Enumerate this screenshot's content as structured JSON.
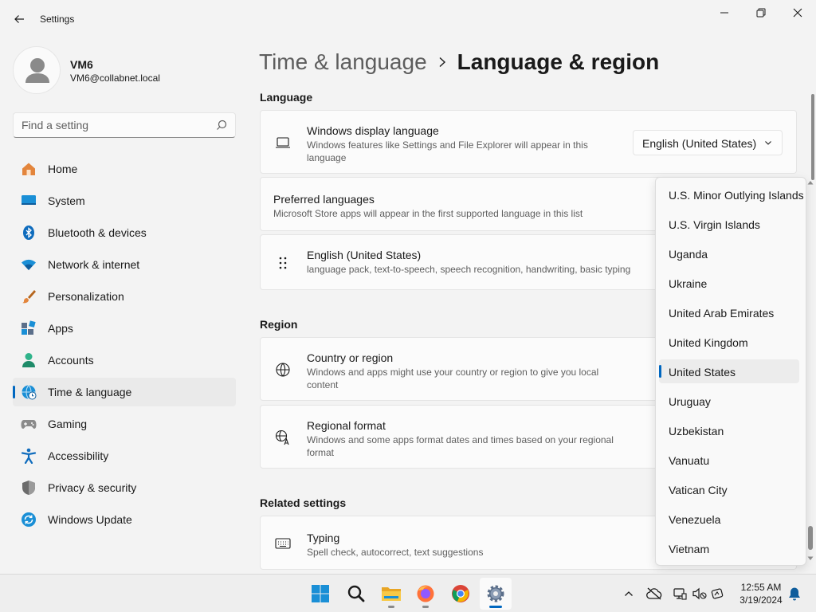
{
  "window": {
    "title": "Settings"
  },
  "profile": {
    "name": "VM6",
    "email": "VM6@collabnet.local"
  },
  "search": {
    "placeholder": "Find a setting"
  },
  "sidebar": {
    "items": [
      {
        "label": "Home",
        "icon": "home-icon",
        "active": false
      },
      {
        "label": "System",
        "icon": "system-icon",
        "active": false
      },
      {
        "label": "Bluetooth & devices",
        "icon": "bluetooth-icon",
        "active": false
      },
      {
        "label": "Network & internet",
        "icon": "wifi-icon",
        "active": false
      },
      {
        "label": "Personalization",
        "icon": "brush-icon",
        "active": false
      },
      {
        "label": "Apps",
        "icon": "apps-icon",
        "active": false
      },
      {
        "label": "Accounts",
        "icon": "accounts-icon",
        "active": false
      },
      {
        "label": "Time & language",
        "icon": "time-language-icon",
        "active": true
      },
      {
        "label": "Gaming",
        "icon": "gamepad-icon",
        "active": false
      },
      {
        "label": "Accessibility",
        "icon": "accessibility-icon",
        "active": false
      },
      {
        "label": "Privacy & security",
        "icon": "shield-icon",
        "active": false
      },
      {
        "label": "Windows Update",
        "icon": "update-icon",
        "active": false
      }
    ]
  },
  "header": {
    "parent": "Time & language",
    "current": "Language & region"
  },
  "language": {
    "section_title": "Language",
    "display_language": {
      "title": "Windows display language",
      "desc": "Windows features like Settings and File Explorer will appear in this language",
      "value": "English (United States)"
    },
    "preferred": {
      "title": "Preferred languages",
      "desc": "Microsoft Store apps will appear in the first supported language in this list"
    },
    "installed": {
      "title": "English (United States)",
      "desc": "language pack, text-to-speech, speech recognition, handwriting, basic typing"
    }
  },
  "region": {
    "section_title": "Region",
    "country": {
      "title": "Country or region",
      "desc": "Windows and apps might use your country or region to give you local content"
    },
    "format": {
      "title": "Regional format",
      "desc": "Windows and some apps format dates and times based on your regional format"
    }
  },
  "related": {
    "section_title": "Related settings",
    "typing": {
      "title": "Typing",
      "desc": "Spell check, autocorrect, text suggestions"
    }
  },
  "country_dropdown": {
    "selected": "United States",
    "options": [
      "U.S. Minor Outlying Islands",
      "U.S. Virgin Islands",
      "Uganda",
      "Ukraine",
      "United Arab Emirates",
      "United Kingdom",
      "United States",
      "Uruguay",
      "Uzbekistan",
      "Vanuatu",
      "Vatican City",
      "Venezuela",
      "Vietnam"
    ]
  },
  "taskbar": {
    "apps": [
      "windows-start-icon",
      "search-icon",
      "file-explorer-icon",
      "firefox-icon",
      "chrome-icon",
      "settings-icon"
    ],
    "active_app": "settings-icon"
  },
  "clock": {
    "time": "12:55 AM",
    "date": "3/19/2024"
  },
  "colors": {
    "accent": "#0067c0",
    "window_bg": "#f3f3f3",
    "card_bg": "#fbfbfb"
  }
}
